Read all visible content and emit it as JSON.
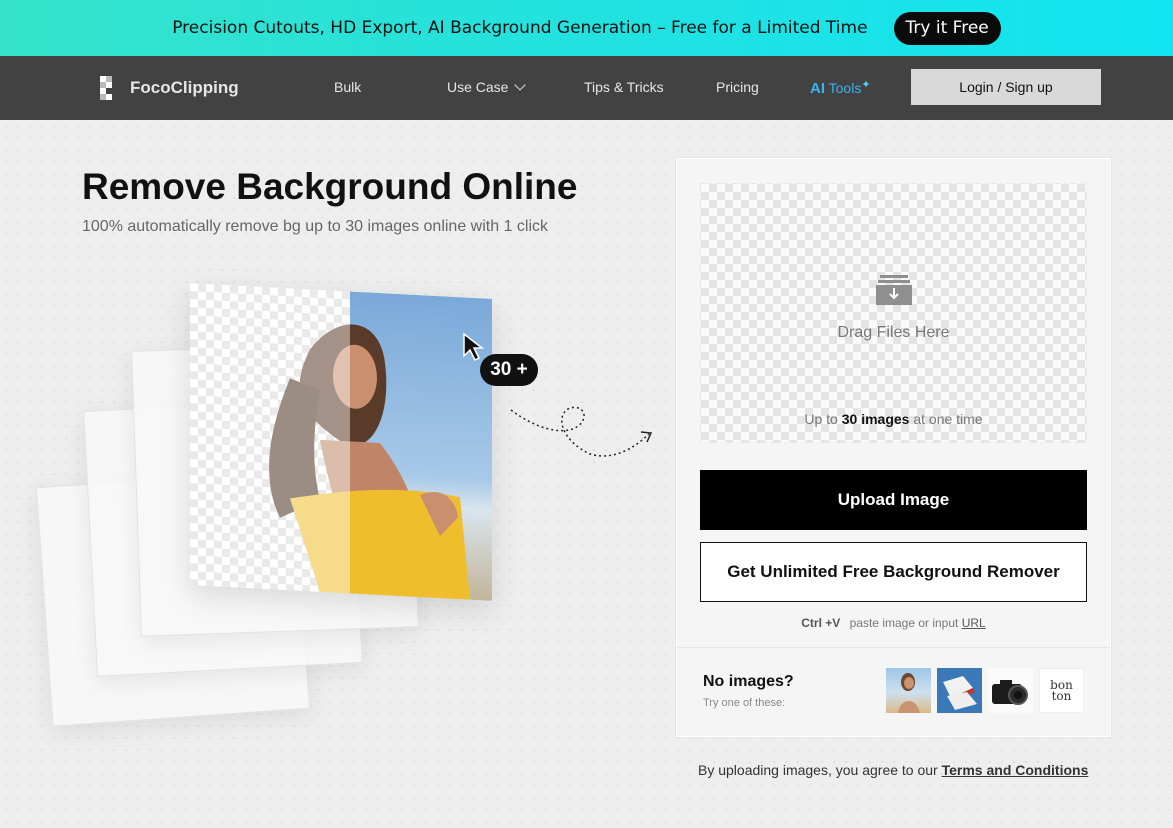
{
  "promo": {
    "text": "Precision Cutouts, HD Export, AI Background Generation – Free for a Limited Time",
    "cta": "Try it Free"
  },
  "nav": {
    "logo": "FocoClipping",
    "items": [
      "Bulk",
      "Use Case",
      "Tips & Tricks",
      "Pricing"
    ],
    "ai_tools_prefix": "AI",
    "ai_tools_suffix": "Tools",
    "login": "Login / Sign up"
  },
  "hero": {
    "title": "Remove Background Online",
    "subtitle": "100% automatically remove bg up to 30 images online with 1 click",
    "badge": "30 +"
  },
  "upload": {
    "drop_text": "Drag Files Here",
    "limit_prefix": "Up to",
    "limit_bold": "30 images",
    "limit_suffix": "at one time",
    "upload_button": "Upload Image",
    "unlimited_button": "Get Unlimited Free Background Remover",
    "paste_key": "Ctrl +V",
    "paste_text": "paste image or input",
    "paste_link": "URL"
  },
  "samples": {
    "title": "No images?",
    "hint": "Try one of these:",
    "logo_text_top": "bon",
    "logo_text_bottom": "ton"
  },
  "footer": {
    "terms_prefix": "By uploading images, you agree to our",
    "terms_link": "Terms and Conditions"
  }
}
